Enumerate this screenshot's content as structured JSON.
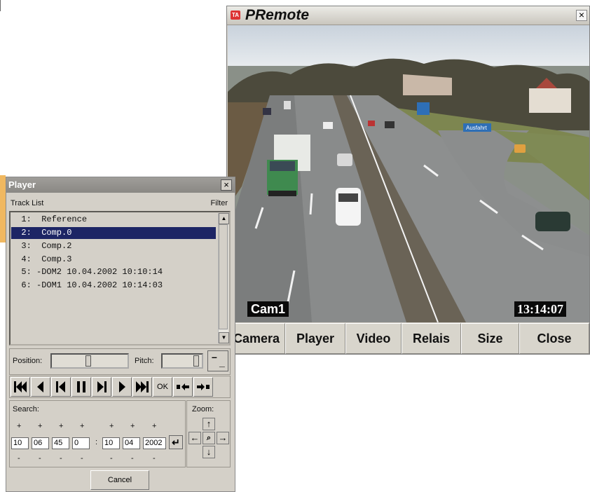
{
  "premote": {
    "title": "PRemote",
    "logo": "TA",
    "close_glyph": "×",
    "cam_label": "Cam1",
    "cam_time": "13:14:07",
    "road_sign": "Ausfahrt",
    "buttons": [
      "Camera",
      "Player",
      "Video",
      "Relais",
      "Size",
      "Close"
    ]
  },
  "player": {
    "title": "Player",
    "close_glyph": "×",
    "track_list_label": "Track List",
    "filter_label": "Filter",
    "tracks": [
      "  1:  Reference",
      "  2:  Comp.0",
      "  3:  Comp.2",
      "  4:  Comp.3",
      "  5: -DOM2 10.04.2002 10:10:14",
      "  6: -DOM1 10.04.2002 10:14:03"
    ],
    "selected_track_index": 1,
    "position_label": "Position:",
    "pitch_label": "Pitch:",
    "ok_label": "OK",
    "search_label": "Search:",
    "zoom_label": "Zoom:",
    "search_fields": [
      "10",
      "06",
      "45",
      "0",
      "10",
      "04",
      "2002"
    ],
    "colon": ":",
    "plus": "+",
    "minus": "-",
    "cancel_label": "Cancel",
    "pitch_minus": "–",
    "pitch_minus_low": "_"
  },
  "colors": {
    "selection": "#1d2565",
    "window_bg": "#d4d0c8",
    "title_gray": "#8a8884"
  },
  "icons": [
    "first-frame-icon",
    "step-back-icon",
    "prev-mark-icon",
    "pause-icon",
    "next-mark-icon",
    "play-icon",
    "last-frame-icon",
    "mark-in-icon",
    "mark-out-icon",
    "zoom-up-icon",
    "zoom-left-icon",
    "zoom-reset-icon",
    "zoom-right-icon",
    "zoom-down-icon",
    "enter-icon"
  ]
}
